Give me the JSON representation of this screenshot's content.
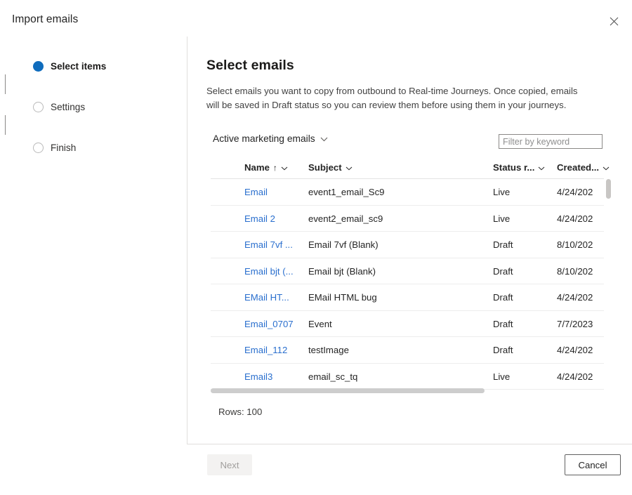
{
  "dialog": {
    "title": "Import emails",
    "close_icon": "close-icon"
  },
  "stepper": {
    "steps": [
      {
        "label": "Select items",
        "state": "active"
      },
      {
        "label": "Settings",
        "state": "inactive"
      },
      {
        "label": "Finish",
        "state": "inactive"
      }
    ]
  },
  "main": {
    "title": "Select emails",
    "description": "Select emails you want to copy from outbound to Real-time Journeys. Once copied, emails will be saved in Draft status so you can review them before using them in your journeys."
  },
  "toolbar": {
    "view_selector_label": "Active marketing emails",
    "view_selector_icon": "chevron-down-icon",
    "filter_placeholder": "Filter by keyword",
    "filter_value": ""
  },
  "grid": {
    "columns": [
      {
        "key": "name",
        "label": "Name",
        "sort": "↑",
        "menu_icon": "chevron-down-icon"
      },
      {
        "key": "subject",
        "label": "Subject",
        "sort": "",
        "menu_icon": "chevron-down-icon"
      },
      {
        "key": "status",
        "label": "Status r...",
        "sort": "",
        "menu_icon": "chevron-down-icon"
      },
      {
        "key": "created",
        "label": "Created...",
        "sort": "",
        "menu_icon": "chevron-down-icon"
      }
    ],
    "rows": [
      {
        "name": "Email",
        "subject": "event1_email_Sc9",
        "status": "Live",
        "created": "4/24/202"
      },
      {
        "name": "Email 2",
        "subject": "event2_email_sc9",
        "status": "Live",
        "created": "4/24/202"
      },
      {
        "name": "Email 7vf ...",
        "subject": "Email 7vf (Blank)",
        "status": "Draft",
        "created": "8/10/202"
      },
      {
        "name": "Email bjt (...",
        "subject": "Email bjt (Blank)",
        "status": "Draft",
        "created": "8/10/202"
      },
      {
        "name": "EMail HT...",
        "subject": "EMail HTML bug",
        "status": "Draft",
        "created": "4/24/202"
      },
      {
        "name": "Email_0707",
        "subject": "Event",
        "status": "Draft",
        "created": "7/7/2023"
      },
      {
        "name": "Email_112",
        "subject": "testImage",
        "status": "Draft",
        "created": "4/24/202"
      },
      {
        "name": "Email3",
        "subject": "email_sc_tq",
        "status": "Live",
        "created": "4/24/202"
      }
    ],
    "rows_count_label": "Rows: 100"
  },
  "footer": {
    "next_label": "Next",
    "cancel_label": "Cancel"
  },
  "colors": {
    "accent": "#0f6cbd",
    "link": "#2a6fce",
    "divider": "#e1dfdd",
    "disabled_text": "#a19f9d"
  }
}
